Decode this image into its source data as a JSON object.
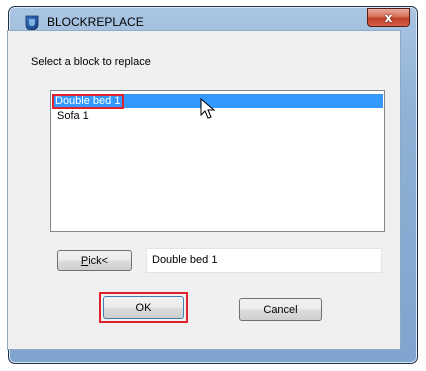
{
  "window": {
    "title": "BLOCKREPLACE",
    "close_glyph": "x",
    "app_icon": "blockreplace-app-icon"
  },
  "dialog": {
    "prompt": "Select a block to replace",
    "blocks": [
      {
        "name": "Double bed 1",
        "selected": true,
        "highlighted": true
      },
      {
        "name": "Sofa 1",
        "selected": false,
        "highlighted": false
      }
    ],
    "pick_button": {
      "underline_char": "P",
      "rest": "ick<"
    },
    "selected_value": "Double bed 1",
    "ok_label": "OK",
    "cancel_label": "Cancel"
  },
  "colors": {
    "selection": "#3399ff",
    "annotation_red": "#e0202a",
    "close_button": "#c1402a"
  }
}
